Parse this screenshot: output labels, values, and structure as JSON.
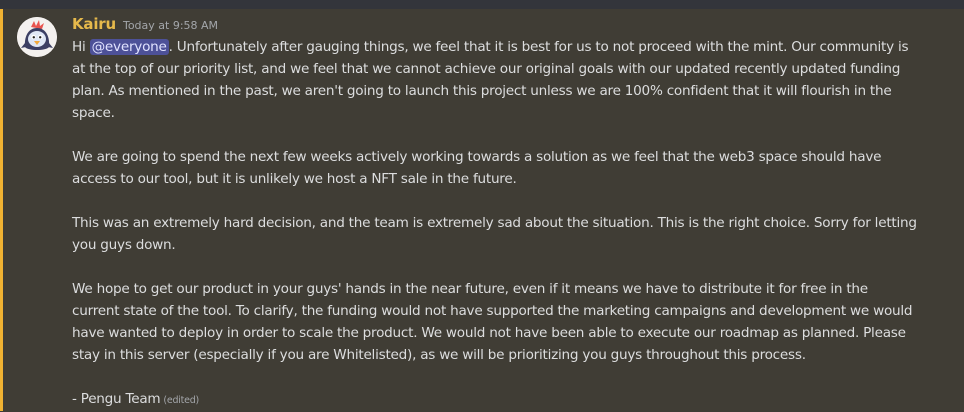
{
  "message": {
    "author": "Kairu",
    "timestamp": "Today at 9:58 AM",
    "greeting": "Hi ",
    "mention": "@everyone",
    "p1_rest": ". Unfortunately after gauging things, we feel that it is best for us to not proceed with the mint. Our community is at the top of our priority list, and we feel that we cannot achieve our original goals with our updated recently updated funding plan. As mentioned in the past, we aren't going to launch this project unless we are 100% confident that it will flourish in the space.",
    "p2": "We are going to spend the next few weeks actively working towards a solution as we feel that the web3 space should have access to our tool, but it is unlikely we host a NFT sale in the future.",
    "p3": "This was an extremely hard decision, and the team is extremely sad about the situation. This is the right choice. Sorry for letting you guys down.",
    "p4": "We hope to get our product in your guys' hands in the near future, even if it means we have to distribute it for free in the current state of the tool. To clarify, the funding would not have supported the marketing campaigns and development we would have wanted to deploy in order to scale the product. We would not have been able to execute our roadmap as planned. Please stay in this server (especially if you are Whitelisted), as we will be prioritizing you guys throughout this process.",
    "signature": "- Pengu Team",
    "edited_label": "(edited)"
  },
  "colors": {
    "username": "#e6b94b",
    "mention_bg": "#4d5198",
    "highlight_bar": "#f0b232",
    "background": "#403d35"
  },
  "icons": {
    "avatar": "penguin-avatar-icon"
  }
}
